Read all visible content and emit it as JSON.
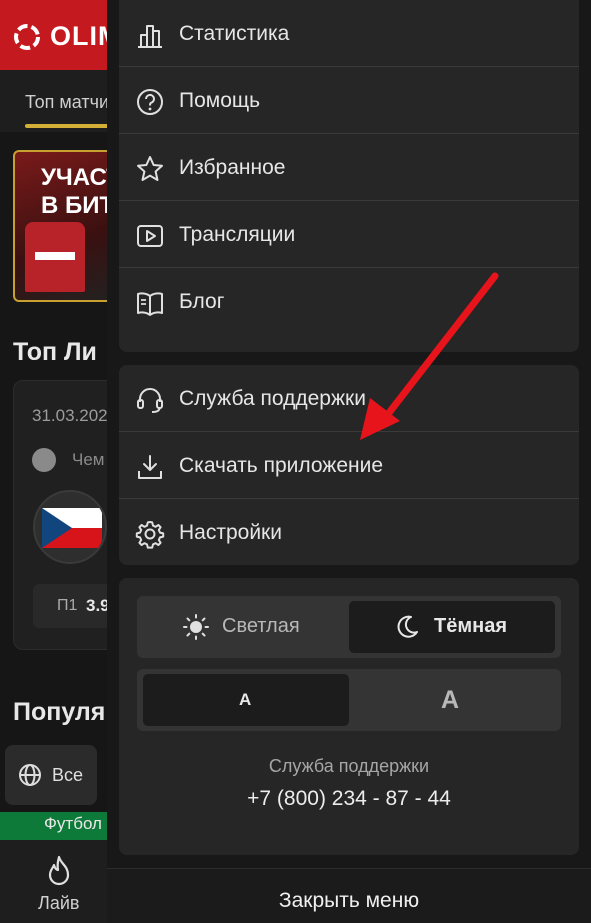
{
  "background_page": {
    "logo_text": "OLIM",
    "tab_label": "Топ матчи",
    "banner_text_line1": "УЧАСТВ",
    "banner_text_line2": "В БИТ",
    "top_leagues_title": "Топ Ли",
    "match_date": "31.03.202",
    "championship": "Чем",
    "odd_label": "П1",
    "odd_value": "3.9",
    "popular_title": "Популя",
    "filter_all": "Все",
    "football_label": "Футбол",
    "bottom_nav_live": "Лайв",
    "colors": {
      "header": "#c41a1f",
      "tab_underline": "#d4af37",
      "football_bar": "#0e7a3a"
    }
  },
  "menu": {
    "group1": [
      {
        "icon": "bar-chart-icon",
        "label": "Статистика"
      },
      {
        "icon": "question-circle-icon",
        "label": "Помощь"
      },
      {
        "icon": "star-icon",
        "label": "Избранное"
      },
      {
        "icon": "play-icon",
        "label": "Трансляции"
      },
      {
        "icon": "book-icon",
        "label": "Блог"
      }
    ],
    "group2": [
      {
        "icon": "headset-icon",
        "label": "Служба поддержки"
      },
      {
        "icon": "download-icon",
        "label": "Скачать приложение"
      },
      {
        "icon": "gear-icon",
        "label": "Настройки"
      }
    ],
    "theme": {
      "light_label": "Светлая",
      "dark_label": "Тёмная",
      "selected": "dark"
    },
    "font_size": {
      "small_label": "A",
      "large_label": "A",
      "selected": "small"
    },
    "support": {
      "label": "Служба поддержки",
      "phone": "+7 (800) 234 - 87 - 44"
    },
    "close_label": "Закрыть меню"
  },
  "annotation": {
    "arrow_color": "#e8141b"
  }
}
